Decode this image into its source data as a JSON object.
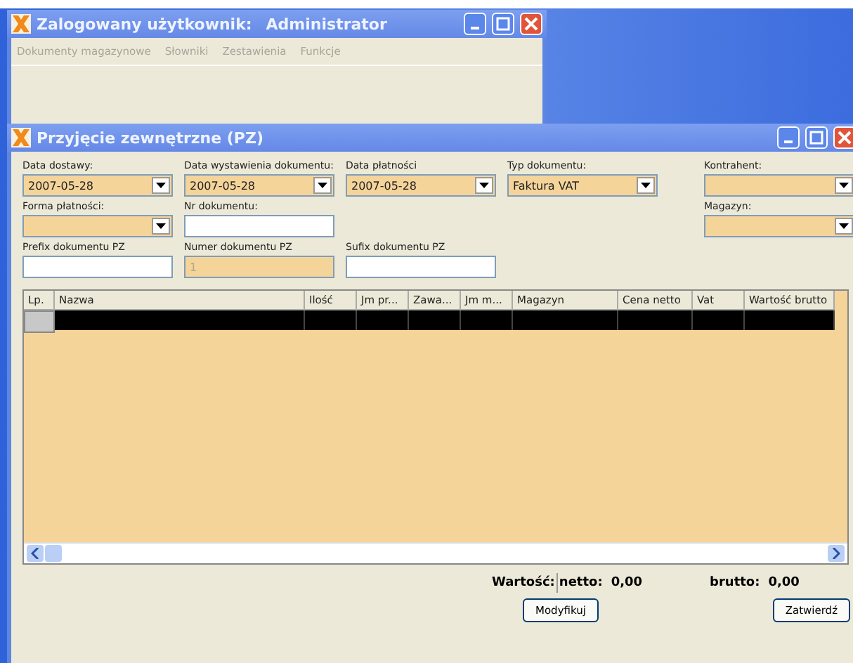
{
  "main_window": {
    "title_label": "Zalogowany użytkownik:",
    "title_user": "Administrator",
    "menu": [
      "Dokumenty magazynowe",
      "Słowniki",
      "Zestawienia",
      "Funkcje"
    ]
  },
  "document_window": {
    "title": "Przyjęcie zewnętrzne (PZ)",
    "field_rows": [
      [
        {
          "label": "Data dostawy:",
          "kind": "combo",
          "value": "2007-05-28"
        },
        {
          "label": "Data wystawienia dokumentu:",
          "kind": "combo",
          "value": "2007-05-28"
        },
        {
          "label": "Data płatności",
          "kind": "combo",
          "value": "2007-05-28"
        },
        {
          "label": "Typ dokumentu:",
          "kind": "combo",
          "value": "Faktura VAT"
        }
      ],
      [
        {
          "label": "Forma płatności:",
          "kind": "combo"
        },
        {
          "label": "Nr dokumentu:",
          "kind": "text"
        }
      ],
      [
        {
          "label": "Prefix dokumentu PZ",
          "kind": "text"
        },
        {
          "label": "Numer dokumentu PZ",
          "kind": "text",
          "value": "1",
          "disabled": true
        },
        {
          "label": "Sufix dokumentu PZ",
          "kind": "text"
        }
      ]
    ],
    "side_fields": [
      {
        "label": "Kontrahent:",
        "kind": "combo"
      },
      {
        "label": "Magazyn:",
        "kind": "combo"
      }
    ],
    "table": {
      "columns": [
        "Lp.",
        "Nazwa",
        "Ilość",
        "Jm pr...",
        "Zawa...",
        "Jm m...",
        "Magazyn",
        "Cena netto",
        "Vat",
        "Wartość brutto"
      ],
      "rows": [
        {
          "selected": true
        }
      ]
    },
    "totals": {
      "label": "Wartość:",
      "netto_label": "netto:",
      "netto": "0,00",
      "brutto_label": "brutto:",
      "brutto": "0,00"
    },
    "buttons": [
      "Modyfikuj",
      "Zatwierdź"
    ]
  }
}
